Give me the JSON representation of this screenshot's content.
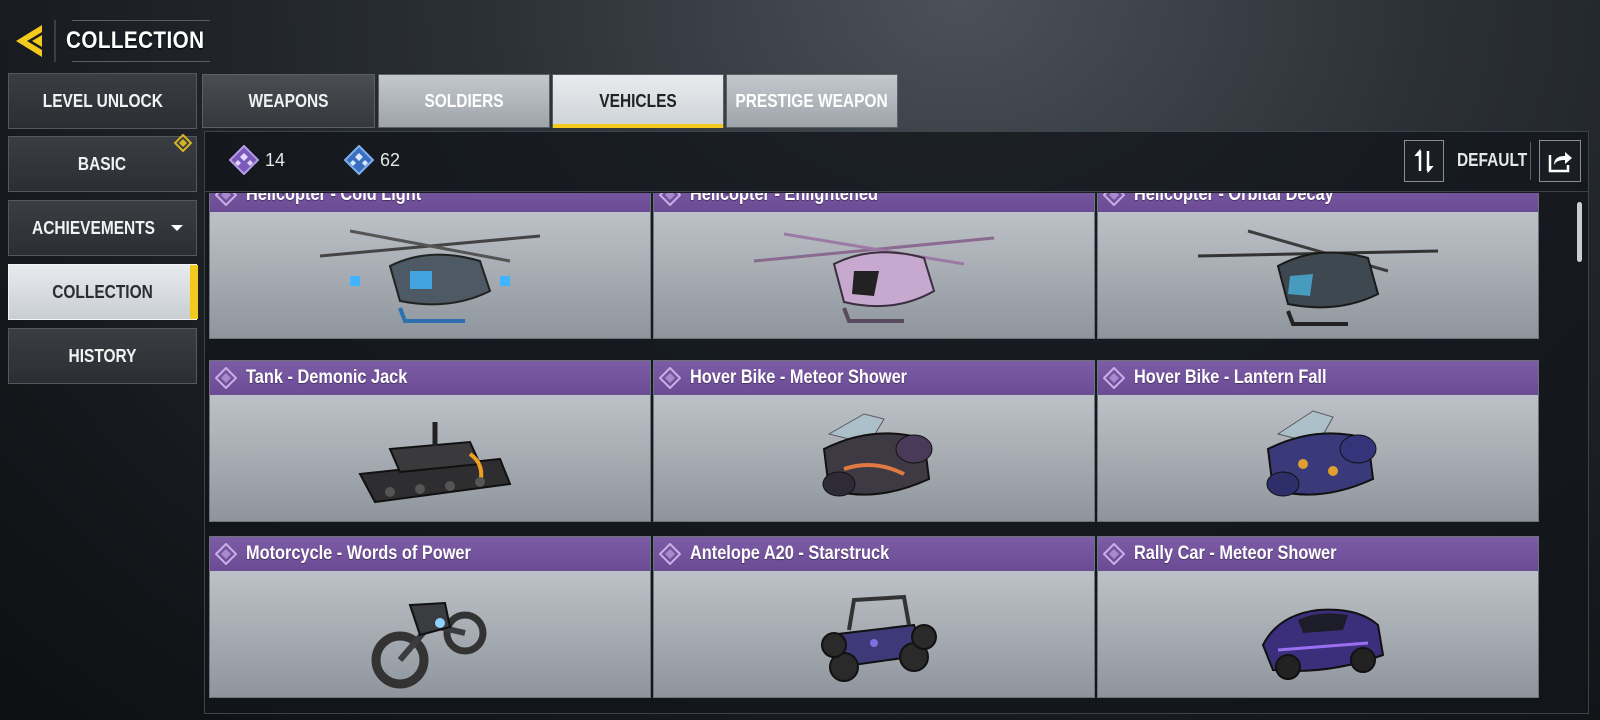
{
  "header": {
    "title": "COLLECTION"
  },
  "sidebar": {
    "items": [
      {
        "label": "LEVEL UNLOCK"
      },
      {
        "label": "BASIC"
      },
      {
        "label": "ACHIEVEMENTS"
      },
      {
        "label": "COLLECTION"
      },
      {
        "label": "HISTORY"
      }
    ]
  },
  "tabs": [
    {
      "label": "WEAPONS"
    },
    {
      "label": "SOLDIERS"
    },
    {
      "label": "VEHICLES"
    },
    {
      "label": "PRESTIGE WEAPON"
    }
  ],
  "toolbar": {
    "count_purple": "14",
    "count_blue": "62",
    "sort_label": "DEFAULT"
  },
  "cards": [
    {
      "title": "Helicopter - Cold Light",
      "art": "helicopter-icon",
      "tint": "#5a6a7a",
      "accent": "#41b4ff"
    },
    {
      "title": "Helicopter - Enlightened",
      "art": "helicopter-icon",
      "tint": "#b48cc0",
      "accent": "#d9a6e0"
    },
    {
      "title": "Helicopter - Orbital Decay",
      "art": "helicopter-icon",
      "tint": "#3f4a52",
      "accent": "#4ab0d9"
    },
    {
      "title": "Tank - Demonic Jack",
      "art": "tank-icon",
      "tint": "#3b3b3e",
      "accent": "#f0a020"
    },
    {
      "title": "Hover Bike - Meteor Shower",
      "art": "hover-bike-icon",
      "tint": "#3d3a44",
      "accent": "#e07a40"
    },
    {
      "title": "Hover Bike - Lantern Fall",
      "art": "hover-bike-icon",
      "tint": "#3a3a7a",
      "accent": "#e0a030"
    },
    {
      "title": "Motorcycle - Words of Power",
      "art": "motorcycle-icon",
      "tint": "#3a3c40",
      "accent": "#8fd0ff"
    },
    {
      "title": "Antelope A20 - Starstruck",
      "art": "buggy-icon",
      "tint": "#3e3a7a",
      "accent": "#7f6fe0"
    },
    {
      "title": "Rally Car - Meteor Shower",
      "art": "rally-car-icon",
      "tint": "#3b2e7a",
      "accent": "#9a6ff0"
    }
  ],
  "colors": {
    "accent_yellow": "#f3c91c",
    "card_header_purple": "#6a4b94",
    "count_purple": "#a07ad8",
    "count_blue": "#4a86d6"
  }
}
